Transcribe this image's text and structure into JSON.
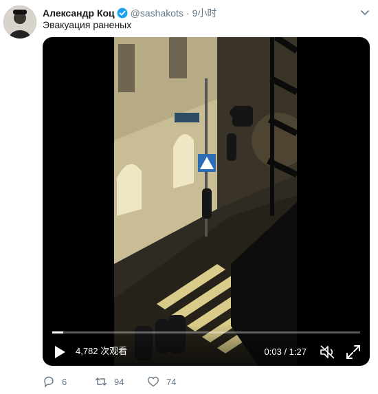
{
  "tweet": {
    "author_name": "Александр Коц",
    "handle": "@sashakots",
    "separator": "·",
    "timestamp": "9小时",
    "text": "Эвакуация раненых"
  },
  "video": {
    "views": "4,782 次观看",
    "timecode": "0:03 / 1:27",
    "progress": 0.035
  },
  "actions": {
    "replies": "6",
    "retweets": "94",
    "likes": "74"
  },
  "colors": {
    "verified": "#1da1f2",
    "secondary_text": "#657786"
  }
}
